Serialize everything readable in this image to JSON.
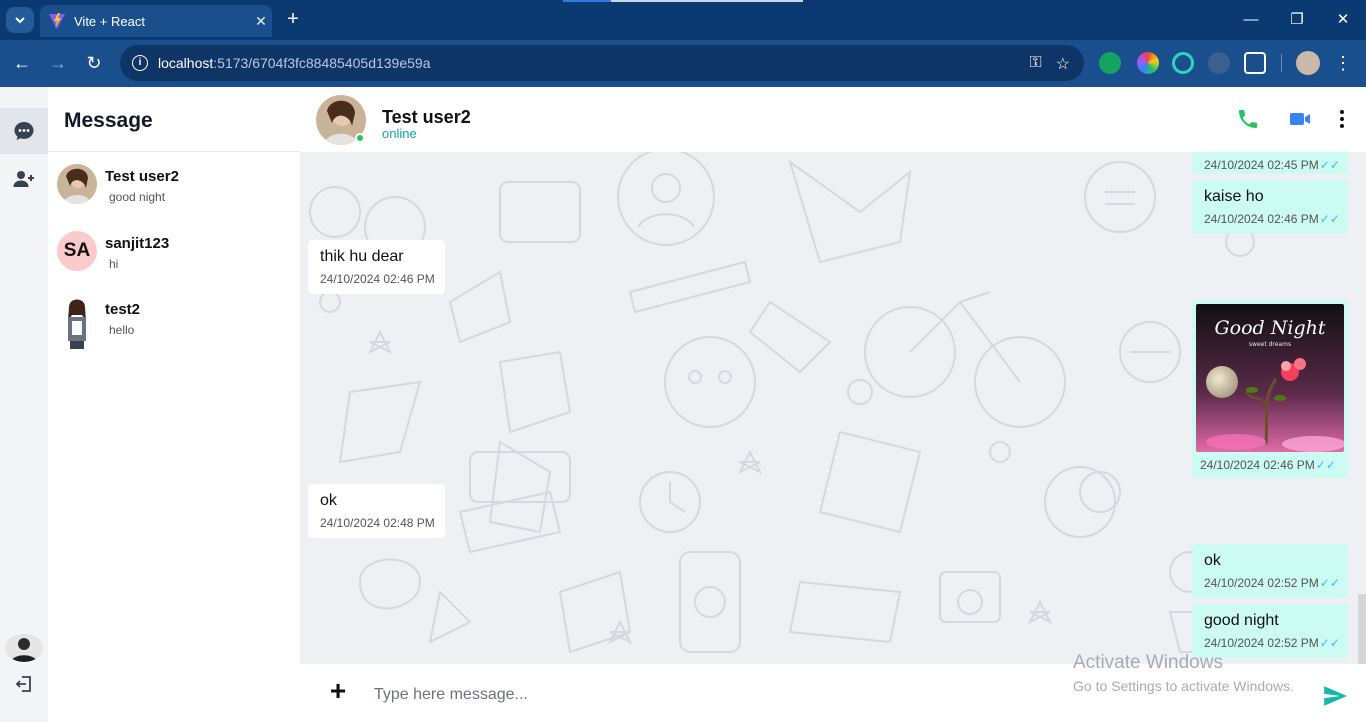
{
  "browser": {
    "tab_title": "Vite + React",
    "url_host": "localhost",
    "url_path": ":5173/6704f3fc88485405d139e59a"
  },
  "sidebar": {
    "title": "Message",
    "contacts": [
      {
        "name": "Test user2",
        "last_message": "good night",
        "avatar": "photo"
      },
      {
        "name": "sanjit123",
        "last_message": "hi",
        "initials": "SA"
      },
      {
        "name": "test2",
        "last_message": "hello",
        "avatar": "photo"
      }
    ]
  },
  "chat_header": {
    "name": "Test user2",
    "status": "online",
    "icons": [
      "phone-icon",
      "video-icon",
      "more-vertical-icon"
    ]
  },
  "messages": [
    {
      "direction": "out",
      "time": "24/10/2024 02:45 PM",
      "ticks": "✓✓"
    },
    {
      "direction": "out",
      "text": "kaise ho",
      "time": "24/10/2024 02:46 PM",
      "ticks": "✓✓"
    },
    {
      "direction": "in",
      "text": "thik hu dear",
      "time": "24/10/2024 02:46 PM"
    },
    {
      "direction": "out",
      "image": {
        "title": "Good Night",
        "subtitle": "sweet dreams"
      },
      "time": "24/10/2024 02:46 PM",
      "ticks": "✓✓"
    },
    {
      "direction": "in",
      "text": "ok",
      "time": "24/10/2024 02:48 PM"
    },
    {
      "direction": "out",
      "text": "ok",
      "time": "24/10/2024 02:52 PM",
      "ticks": "✓✓"
    },
    {
      "direction": "out",
      "text": "good night",
      "time": "24/10/2024 02:52 PM",
      "ticks": "✓✓"
    }
  ],
  "composer": {
    "placeholder": "Type here message..."
  },
  "watermark": {
    "line1": "Activate Windows",
    "line2": "Go to Settings to activate Windows."
  },
  "colors": {
    "browser_frame": "#0b3a73",
    "browser_toolbar": "#1a4f8d",
    "outgoing_bubble": "#ccfbf1",
    "incoming_bubble": "#ffffff",
    "accent_teal": "#0ea5a5",
    "online_green": "#22c55e",
    "phone_green": "#22c55e",
    "video_blue": "#3b82f6",
    "send_teal": "#14b8a6"
  }
}
